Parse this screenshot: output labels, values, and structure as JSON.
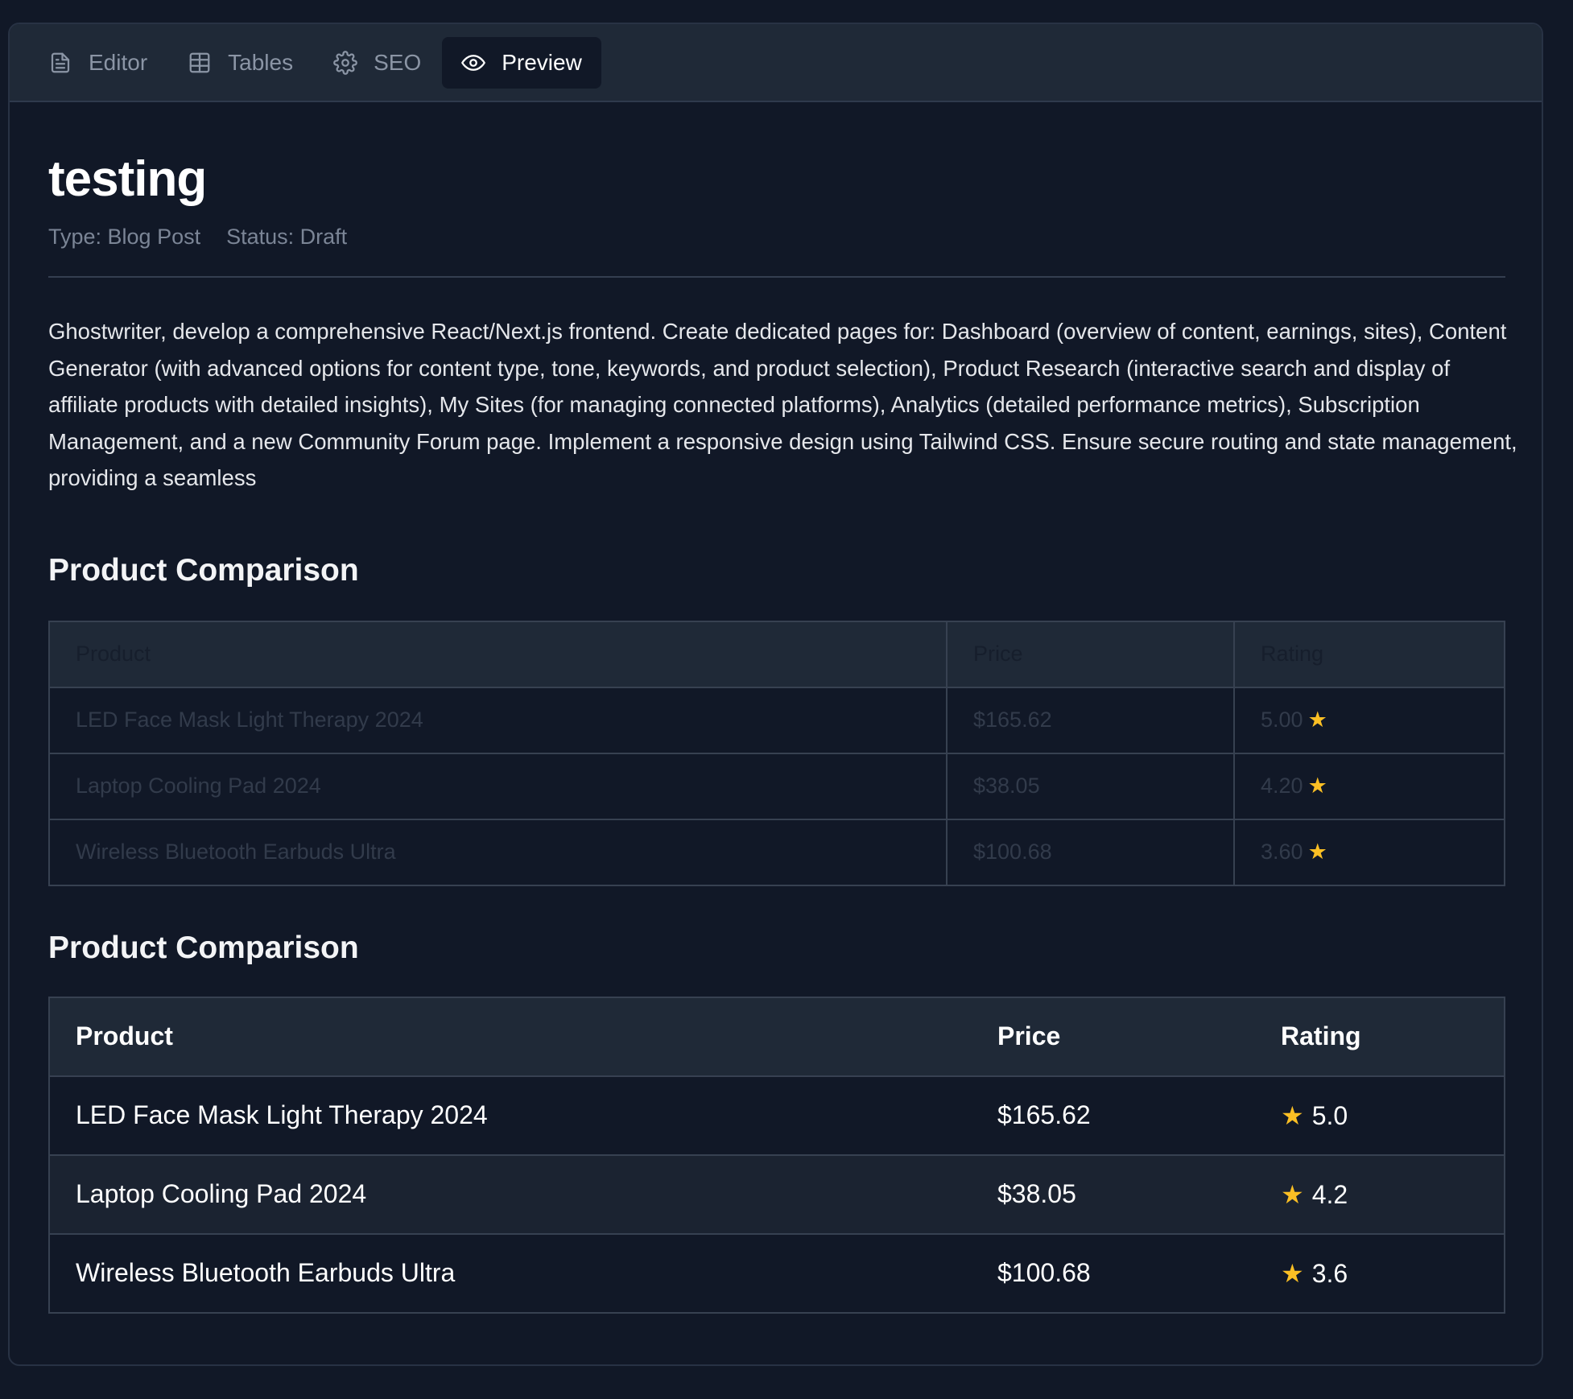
{
  "tabs": [
    {
      "label": "Editor",
      "icon": "document-icon"
    },
    {
      "label": "Tables",
      "icon": "table-icon"
    },
    {
      "label": "SEO",
      "icon": "gear-icon"
    },
    {
      "label": "Preview",
      "icon": "eye-icon",
      "active": true
    }
  ],
  "post": {
    "title": "testing",
    "type_label": "Type: Blog Post",
    "status_label": "Status: Draft",
    "body": "Ghostwriter, develop a comprehensive React/Next.js frontend. Create dedicated pages for: Dashboard (overview of content, earnings, sites), Content Generator (with advanced options for content type, tone, keywords, and product selection), Product Research (interactive search and display of affiliate products with detailed insights), My Sites (for managing connected platforms), Analytics (detailed performance metrics), Subscription Management, and a new Community Forum page. Implement a responsive design using Tailwind CSS. Ensure secure routing and state management, providing a seamless"
  },
  "comparison_1": {
    "heading": "Product Comparison",
    "headers": {
      "product": "Product",
      "price": "Price",
      "rating": "Rating"
    },
    "rows": [
      {
        "product": "LED Face Mask Light Therapy 2024",
        "price": "$165.62",
        "rating": "5.00"
      },
      {
        "product": "Laptop Cooling Pad 2024",
        "price": "$38.05",
        "rating": "4.20"
      },
      {
        "product": "Wireless Bluetooth Earbuds Ultra",
        "price": "$100.68",
        "rating": "3.60"
      }
    ]
  },
  "comparison_2": {
    "heading": "Product Comparison",
    "headers": {
      "product": "Product",
      "price": "Price",
      "rating": "Rating"
    },
    "rows": [
      {
        "product": "LED Face Mask Light Therapy 2024",
        "price": "$165.62",
        "rating": "5.0"
      },
      {
        "product": "Laptop Cooling Pad 2024",
        "price": "$38.05",
        "rating": "4.2"
      },
      {
        "product": "Wireless Bluetooth Earbuds Ultra",
        "price": "$100.68",
        "rating": "3.6"
      }
    ]
  },
  "colors": {
    "background": "#111827",
    "tabbar": "#1f2937",
    "star": "#fbbf24"
  }
}
